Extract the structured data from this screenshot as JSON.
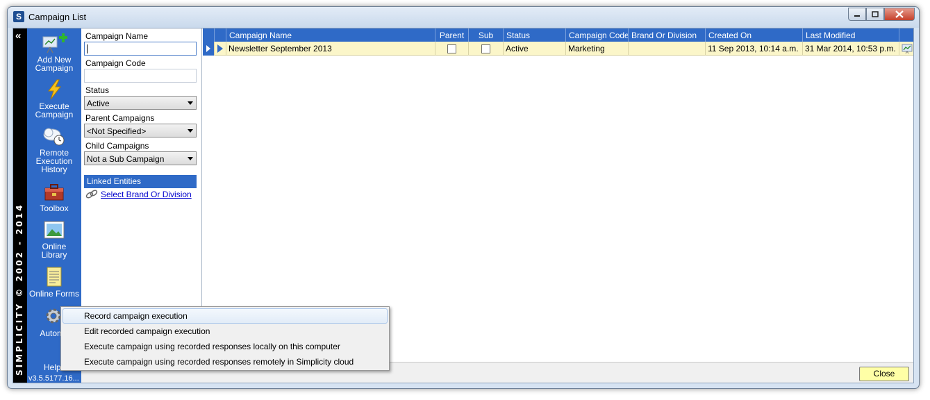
{
  "window": {
    "title": "Campaign List",
    "app_icon": "S"
  },
  "brand": {
    "text": "SIMPLICITY © 2002 - 2014"
  },
  "nav": {
    "items": [
      {
        "label_lines": [
          "Add New",
          "Campaign"
        ],
        "icon": "add-campaign-icon"
      },
      {
        "label_lines": [
          "Execute",
          "Campaign"
        ],
        "icon": "execute-lightning-icon"
      },
      {
        "label_lines": [
          "Remote",
          "Execution",
          "History"
        ],
        "icon": "cloud-clock-icon"
      },
      {
        "label_lines": [
          "Toolbox"
        ],
        "icon": "toolbox-icon"
      },
      {
        "label_lines": [
          "Online",
          "Library"
        ],
        "icon": "library-picture-icon"
      },
      {
        "label_lines": [
          "Online Forms"
        ],
        "icon": "forms-icon"
      },
      {
        "label_lines": [
          "Automa"
        ],
        "icon": "gear-icon"
      }
    ],
    "help": "Help",
    "version": "v3.5.5177.16..."
  },
  "filters": {
    "campaign_name_label": "Campaign Name",
    "campaign_name_value": "",
    "campaign_code_label": "Campaign Code",
    "campaign_code_value": "",
    "status_label": "Status",
    "status_value": "Active",
    "parent_label": "Parent Campaigns",
    "parent_value": "<Not Specified>",
    "child_label": "Child Campaigns",
    "child_value": "Not a Sub Campaign",
    "linked_entities": "Linked Entities",
    "select_brand_link": "Select Brand Or Division"
  },
  "grid": {
    "columns": [
      "Campaign Name",
      "Parent",
      "Sub",
      "Status",
      "Campaign Code",
      "Brand Or Division",
      "Created On",
      "Last Modified"
    ],
    "rows": [
      {
        "campaign_name": "Newsletter September 2013",
        "parent": false,
        "sub": false,
        "status": "Active",
        "campaign_code": "Marketing",
        "brand": "",
        "created_on": "11 Sep 2013, 10:14 a.m.",
        "last_modified": "31 Mar 2014, 10:53 p.m."
      }
    ]
  },
  "context_menu": {
    "items": [
      "Record campaign execution",
      "Edit recorded campaign execution",
      "Execute campaign using recorded responses locally on this computer",
      "Execute campaign using recorded responses remotely in Simplicity cloud"
    ]
  },
  "footer": {
    "close_label": "Close"
  },
  "colors": {
    "accent": "#2f6ac7",
    "row_highlight": "#fbf6c9",
    "close_button": "#ffffa6"
  }
}
